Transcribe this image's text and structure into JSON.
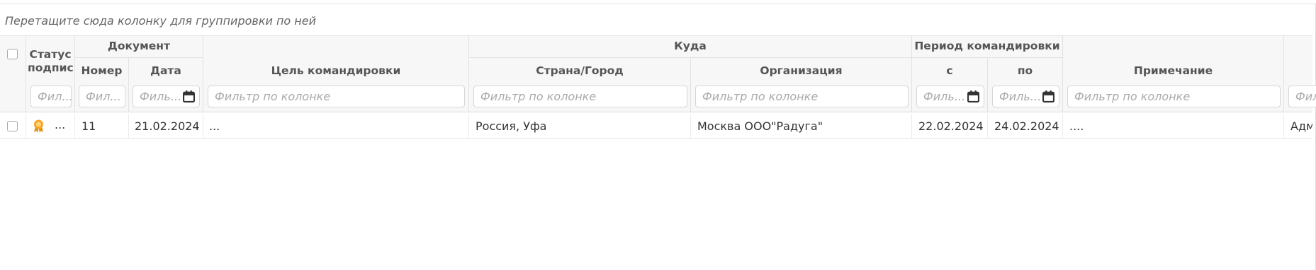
{
  "group_panel": {
    "hint": "Перетащите сюда колонку для группировки по ней"
  },
  "columns": {
    "status": "Статус подпис.",
    "document_group": "Документ",
    "number": "Номер",
    "date": "Дата",
    "purpose": "Цель командировки",
    "destination_group": "Куда",
    "country_city": "Страна/Город",
    "organization": "Организация",
    "period_group": "Период командировки",
    "from": "с",
    "to": "по",
    "note": "Примечание"
  },
  "filters": {
    "status": "Фил...",
    "number": "Фил...",
    "date": "Филь...",
    "purpose": "Фильтр по колонке",
    "country_city": "Фильтр по колонке",
    "organization": "Фильтр по колонке",
    "from": "Филь...",
    "to": "Филь...",
    "note": "Фильтр по колонке",
    "extra": "Фил"
  },
  "rows": [
    {
      "status_icon": "certificate-icon",
      "status_extra": "...",
      "number": "11",
      "date": "21.02.2024",
      "purpose": "...",
      "country_city": "Россия, Уфа",
      "organization": "Москва ООО\"Радуга\"",
      "from": "22.02.2024",
      "to": "24.02.2024",
      "note": "....",
      "extra": "Адм"
    }
  ],
  "colors": {
    "header_bg": "#f7f7f7",
    "border": "#dcdcdc",
    "status_icon": "#f5a623"
  }
}
